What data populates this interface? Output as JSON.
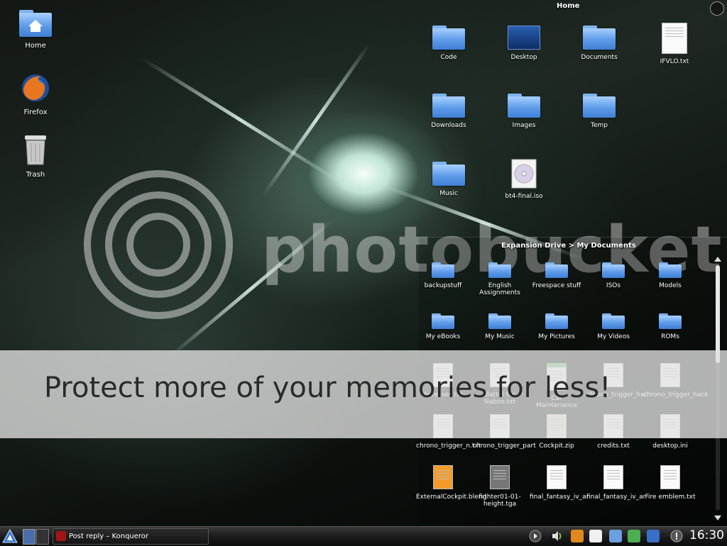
{
  "desktop": {
    "icons": [
      {
        "label": "Home",
        "icon": "home-folder-icon"
      },
      {
        "label": "Firefox",
        "icon": "firefox-icon"
      },
      {
        "label": "Trash",
        "icon": "trash-icon"
      }
    ]
  },
  "home_panel": {
    "title": "Home",
    "items": [
      {
        "label": "Code",
        "icon": "folder-icon"
      },
      {
        "label": "Desktop",
        "icon": "desktop-folder-icon"
      },
      {
        "label": "Documents",
        "icon": "folder-icon"
      },
      {
        "label": "IFVLO.txt",
        "icon": "text-file-icon"
      },
      {
        "label": "Downloads",
        "icon": "folder-icon"
      },
      {
        "label": "Images",
        "icon": "folder-icon"
      },
      {
        "label": "Temp",
        "icon": "folder-icon"
      },
      {
        "label": "Music",
        "icon": "folder-icon"
      },
      {
        "label": "bt4-final.iso",
        "icon": "disc-image-icon"
      }
    ]
  },
  "docs_panel": {
    "title": "Expansion Drive > My Documents",
    "items": [
      {
        "label": "backupstuff",
        "icon": "folder-icon"
      },
      {
        "label": "English Assignments",
        "icon": "folder-icon"
      },
      {
        "label": "Freespace stuff",
        "icon": "folder-icon"
      },
      {
        "label": "ISOs",
        "icon": "folder-icon"
      },
      {
        "label": "Models",
        "icon": "folder-icon"
      },
      {
        "label": "My eBooks",
        "icon": "folder-icon"
      },
      {
        "label": "My Music",
        "icon": "folder-icon"
      },
      {
        "label": "My Pictures",
        "icon": "folder-icon"
      },
      {
        "label": "My Videos",
        "icon": "folder-icon"
      },
      {
        "label": "ROMs",
        "icon": "folder-icon"
      },
      {
        "label": "Adresses.txt",
        "icon": "text-file-icon"
      },
      {
        "label": "Battel for Naboo.txt",
        "icon": "text-file-icon"
      },
      {
        "label": "Car Maintenance",
        "icon": "spreadsheet-icon"
      },
      {
        "label": "chrono_trigger_hac",
        "icon": "text-file-icon"
      },
      {
        "label": "chrono_trigger_hack",
        "icon": "text-file-icon"
      },
      {
        "label": "chrono_trigger_n.txt",
        "icon": "text-file-icon"
      },
      {
        "label": "chrono_trigger_part",
        "icon": "text-file-icon"
      },
      {
        "label": "Cockpit.zip",
        "icon": "zip-file-icon"
      },
      {
        "label": "credits.txt",
        "icon": "text-file-icon"
      },
      {
        "label": "desktop.ini",
        "icon": "text-file-icon"
      },
      {
        "label": "ExternalCockpit.blend",
        "icon": "blender-file-icon"
      },
      {
        "label": "fighter01-01-height.tga",
        "icon": "image-file-icon"
      },
      {
        "label": "final_fantasy_iv_ar",
        "icon": "text-file-icon"
      },
      {
        "label": "final_fantasy_iv_ar",
        "icon": "text-file-icon"
      },
      {
        "label": "Fire emblem.txt",
        "icon": "text-file-icon"
      }
    ]
  },
  "watermark": {
    "text": "Protect more of your memories for less!",
    "brand": "photobucket"
  },
  "taskbar": {
    "task_label": "Post reply – Konqueror",
    "clock": "16:30"
  },
  "colors": {
    "folder_blue": "#5d9ae8",
    "taskbar_bg": "#1a1a1a"
  }
}
